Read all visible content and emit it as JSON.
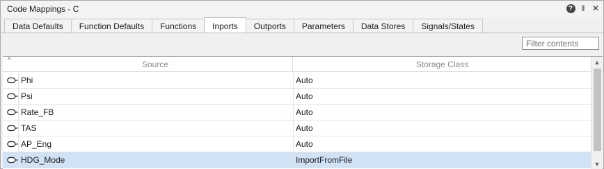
{
  "window": {
    "title": "Code Mappings - C",
    "help_glyph": "?",
    "pin_glyph": "‖",
    "close_glyph": "✕"
  },
  "tabs": [
    {
      "label": "Data Defaults",
      "active": false
    },
    {
      "label": "Function Defaults",
      "active": false
    },
    {
      "label": "Functions",
      "active": false
    },
    {
      "label": "Inports",
      "active": true
    },
    {
      "label": "Outports",
      "active": false
    },
    {
      "label": "Parameters",
      "active": false
    },
    {
      "label": "Data Stores",
      "active": false
    },
    {
      "label": "Signals/States",
      "active": false
    }
  ],
  "filter": {
    "placeholder": "Filter contents",
    "value": ""
  },
  "table": {
    "sort_glyph": "^",
    "columns": {
      "source": "Source",
      "storage_class": "Storage Class"
    },
    "rows": [
      {
        "source": "Phi",
        "storage_class": "Auto",
        "selected": false
      },
      {
        "source": "Psi",
        "storage_class": "Auto",
        "selected": false
      },
      {
        "source": "Rate_FB",
        "storage_class": "Auto",
        "selected": false
      },
      {
        "source": "TAS",
        "storage_class": "Auto",
        "selected": false
      },
      {
        "source": "AP_Eng",
        "storage_class": "Auto",
        "selected": false
      },
      {
        "source": "HDG_Mode",
        "storage_class": "ImportFromFile",
        "selected": true
      }
    ]
  },
  "scrollbar": {
    "up_glyph": "▲",
    "down_glyph": "▼"
  },
  "icons": {
    "row": "inport-icon",
    "help": "help-icon",
    "pin": "pin-icon",
    "close": "close-icon"
  },
  "colors": {
    "selected_row": "#cfe2f6",
    "header_text": "#8a8a8a"
  }
}
